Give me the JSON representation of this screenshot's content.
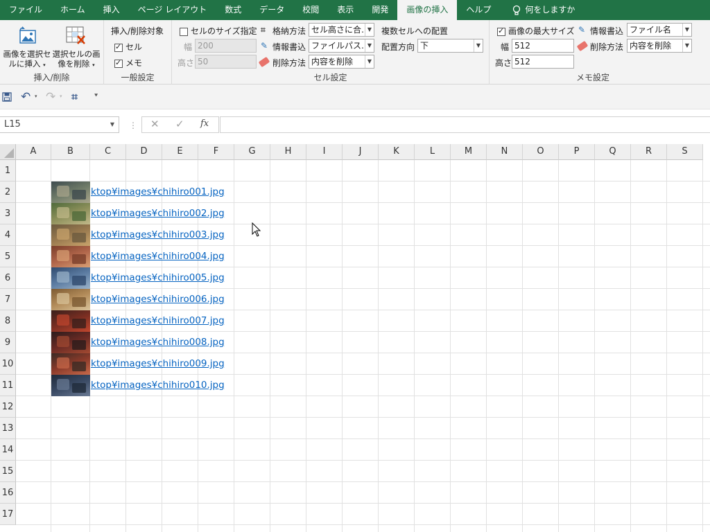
{
  "tabs": [
    {
      "label": "ファイル",
      "active": false
    },
    {
      "label": "ホーム",
      "active": false
    },
    {
      "label": "挿入",
      "active": false
    },
    {
      "label": "ページ レイアウト",
      "active": false
    },
    {
      "label": "数式",
      "active": false
    },
    {
      "label": "データ",
      "active": false
    },
    {
      "label": "校閲",
      "active": false
    },
    {
      "label": "表示",
      "active": false
    },
    {
      "label": "開発",
      "active": false
    },
    {
      "label": "画像の挿入",
      "active": true
    },
    {
      "label": "ヘルプ",
      "active": false
    }
  ],
  "tell_me": "何をしますか",
  "ribbon": {
    "insert_delete": {
      "insert_btn_line1": "画像を選択セ",
      "insert_btn_line2": "ルに挿入",
      "delete_btn_line1": "選択セルの画",
      "delete_btn_line2": "像を削除",
      "group_label": "挿入/削除"
    },
    "general": {
      "title": "挿入/削除対象",
      "cell_label": "セル",
      "cell_checked": true,
      "memo_label": "メモ",
      "memo_checked": true,
      "group_label": "一般設定"
    },
    "cell_settings": {
      "size_label": "セルのサイズ指定",
      "size_checked": false,
      "width_label": "幅",
      "width_value": "200",
      "height_label": "高さ",
      "height_value": "50",
      "storage_label": "格納方法",
      "storage_value": "セル高さに合…",
      "info_label": "情報書込",
      "info_value": "ファイルパス…",
      "delete_label": "削除方法",
      "delete_value": "内容を削除",
      "multi_title": "複数セルへの配置",
      "direction_label": "配置方向",
      "direction_value": "下",
      "group_label": "セル設定"
    },
    "memo_settings": {
      "max_size_label": "画像の最大サイズ",
      "max_size_checked": true,
      "width_label": "幅",
      "width_value": "512",
      "height_label": "高さ",
      "height_value": "512",
      "info_label": "情報書込",
      "info_value": "ファイル名",
      "delete_label": "削除方法",
      "delete_value": "内容を削除",
      "group_label": "メモ設定"
    }
  },
  "name_box": "L15",
  "formula_value": "",
  "columns": [
    "A",
    "B",
    "C",
    "D",
    "E",
    "F",
    "G",
    "H",
    "I",
    "J",
    "K",
    "L",
    "M",
    "N",
    "O",
    "P",
    "Q",
    "R",
    "S"
  ],
  "rows": [
    "1",
    "2",
    "3",
    "4",
    "5",
    "6",
    "7",
    "8",
    "9",
    "10",
    "11",
    "12",
    "13",
    "14",
    "15",
    "16",
    "17"
  ],
  "links": [
    "ktop¥images¥chihiro001.jpg",
    "ktop¥images¥chihiro002.jpg",
    "ktop¥images¥chihiro003.jpg",
    "ktop¥images¥chihiro004.jpg",
    "ktop¥images¥chihiro005.jpg",
    "ktop¥images¥chihiro006.jpg",
    "ktop¥images¥chihiro007.jpg",
    "ktop¥images¥chihiro008.jpg",
    "ktop¥images¥chihiro009.jpg",
    "ktop¥images¥chihiro010.jpg"
  ],
  "thumb_colors": [
    [
      "#3d4a4e",
      "#6f7b68",
      "#a9a58b"
    ],
    [
      "#4f6a3a",
      "#8c8f5a",
      "#c2b98a"
    ],
    [
      "#6b5a3f",
      "#9a7a4f",
      "#c9a46c"
    ],
    [
      "#7a3e2a",
      "#b0654a",
      "#d9a074"
    ],
    [
      "#2f4a6e",
      "#5c7ca2",
      "#9bb3c9"
    ],
    [
      "#7c5a32",
      "#b38c5a",
      "#d8c39a"
    ],
    [
      "#3a1f1c",
      "#7a2e22",
      "#c2462e"
    ],
    [
      "#2b1c1c",
      "#6a2a24",
      "#a34a32"
    ],
    [
      "#3a2a24",
      "#8a3a2a",
      "#c96a4a"
    ],
    [
      "#1f2a3a",
      "#3a4a64",
      "#6a7a94"
    ]
  ],
  "colors": {
    "excel_green": "#217346",
    "link_blue": "#0563c1"
  }
}
